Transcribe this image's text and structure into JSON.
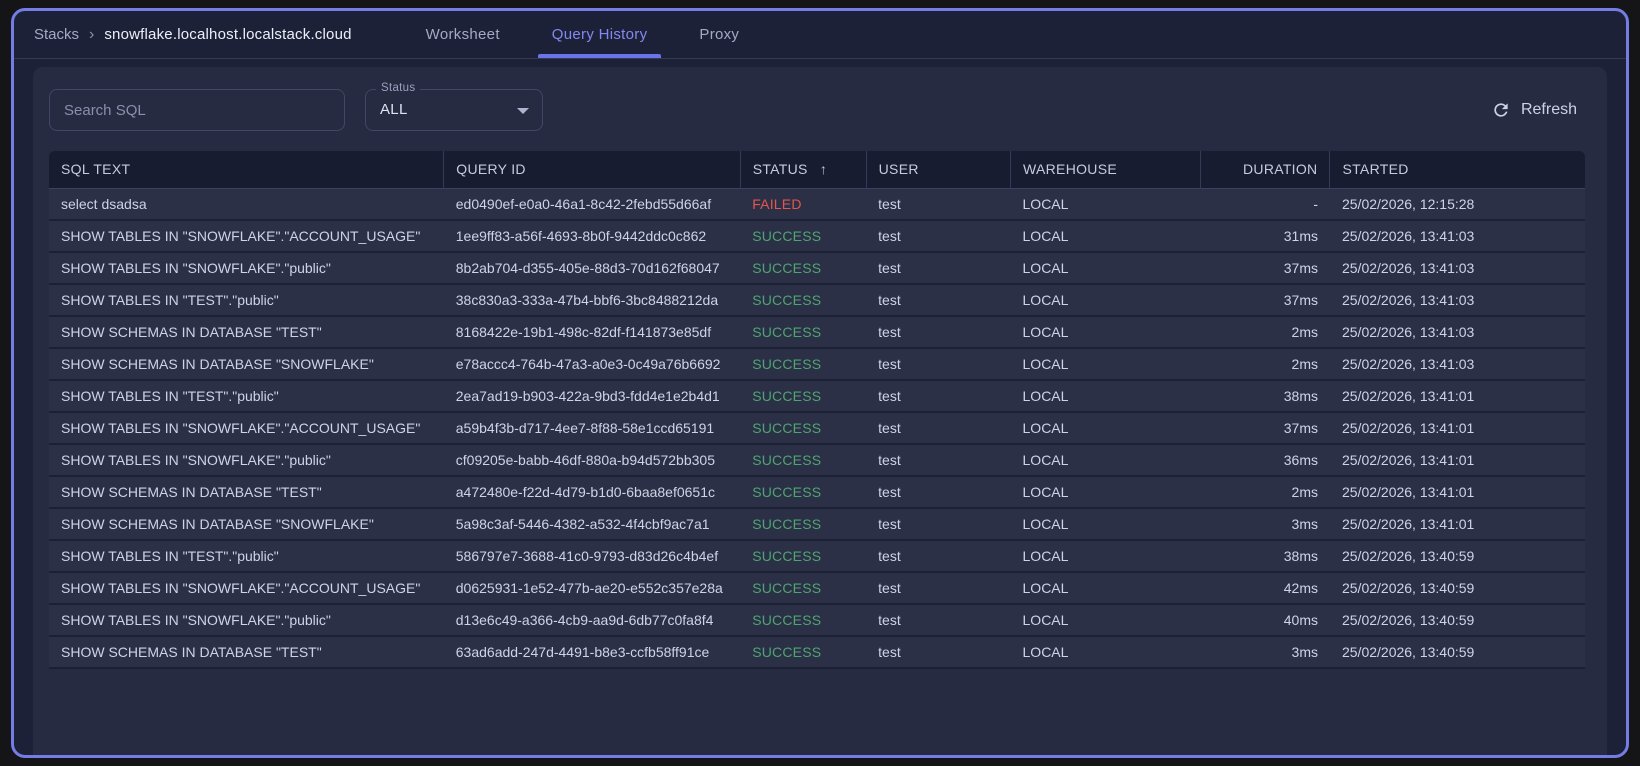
{
  "colors": {
    "accent": "#747ce6",
    "success": "#4fa56f",
    "failed": "#e2574e"
  },
  "breadcrumb": {
    "root": "Stacks",
    "separator": "›",
    "current": "snowflake.localhost.localstack.cloud"
  },
  "tabs": [
    {
      "label": "Worksheet",
      "active": false
    },
    {
      "label": "Query History",
      "active": true
    },
    {
      "label": "Proxy",
      "active": false
    }
  ],
  "toolbar": {
    "search_placeholder": "Search SQL",
    "status_filter": {
      "label": "Status",
      "value": "ALL"
    },
    "refresh_label": "Refresh"
  },
  "table": {
    "columns": [
      "SQL TEXT",
      "QUERY ID",
      "STATUS",
      "USER",
      "WAREHOUSE",
      "DURATION",
      "STARTED"
    ],
    "sort": {
      "column": "STATUS",
      "direction": "asc",
      "arrow": "↑"
    },
    "rows": [
      {
        "sql": "select dsadsa",
        "query_id": "ed0490ef-e0a0-46a1-8c42-2febd55d66af",
        "status": "FAILED",
        "user": "test",
        "warehouse": "LOCAL",
        "duration": "-",
        "started": "25/02/2026, 12:15:28"
      },
      {
        "sql": "SHOW TABLES IN \"SNOWFLAKE\".\"ACCOUNT_USAGE\"",
        "query_id": "1ee9ff83-a56f-4693-8b0f-9442ddc0c862",
        "status": "SUCCESS",
        "user": "test",
        "warehouse": "LOCAL",
        "duration": "31ms",
        "started": "25/02/2026, 13:41:03"
      },
      {
        "sql": "SHOW TABLES IN \"SNOWFLAKE\".\"public\"",
        "query_id": "8b2ab704-d355-405e-88d3-70d162f68047",
        "status": "SUCCESS",
        "user": "test",
        "warehouse": "LOCAL",
        "duration": "37ms",
        "started": "25/02/2026, 13:41:03"
      },
      {
        "sql": "SHOW TABLES IN \"TEST\".\"public\"",
        "query_id": "38c830a3-333a-47b4-bbf6-3bc8488212da",
        "status": "SUCCESS",
        "user": "test",
        "warehouse": "LOCAL",
        "duration": "37ms",
        "started": "25/02/2026, 13:41:03"
      },
      {
        "sql": "SHOW SCHEMAS IN DATABASE \"TEST\"",
        "query_id": "8168422e-19b1-498c-82df-f141873e85df",
        "status": "SUCCESS",
        "user": "test",
        "warehouse": "LOCAL",
        "duration": "2ms",
        "started": "25/02/2026, 13:41:03"
      },
      {
        "sql": "SHOW SCHEMAS IN DATABASE \"SNOWFLAKE\"",
        "query_id": "e78accc4-764b-47a3-a0e3-0c49a76b6692",
        "status": "SUCCESS",
        "user": "test",
        "warehouse": "LOCAL",
        "duration": "2ms",
        "started": "25/02/2026, 13:41:03"
      },
      {
        "sql": "SHOW TABLES IN \"TEST\".\"public\"",
        "query_id": "2ea7ad19-b903-422a-9bd3-fdd4e1e2b4d1",
        "status": "SUCCESS",
        "user": "test",
        "warehouse": "LOCAL",
        "duration": "38ms",
        "started": "25/02/2026, 13:41:01"
      },
      {
        "sql": "SHOW TABLES IN \"SNOWFLAKE\".\"ACCOUNT_USAGE\"",
        "query_id": "a59b4f3b-d717-4ee7-8f88-58e1ccd65191",
        "status": "SUCCESS",
        "user": "test",
        "warehouse": "LOCAL",
        "duration": "37ms",
        "started": "25/02/2026, 13:41:01"
      },
      {
        "sql": "SHOW TABLES IN \"SNOWFLAKE\".\"public\"",
        "query_id": "cf09205e-babb-46df-880a-b94d572bb305",
        "status": "SUCCESS",
        "user": "test",
        "warehouse": "LOCAL",
        "duration": "36ms",
        "started": "25/02/2026, 13:41:01"
      },
      {
        "sql": "SHOW SCHEMAS IN DATABASE \"TEST\"",
        "query_id": "a472480e-f22d-4d79-b1d0-6baa8ef0651c",
        "status": "SUCCESS",
        "user": "test",
        "warehouse": "LOCAL",
        "duration": "2ms",
        "started": "25/02/2026, 13:41:01"
      },
      {
        "sql": "SHOW SCHEMAS IN DATABASE \"SNOWFLAKE\"",
        "query_id": "5a98c3af-5446-4382-a532-4f4cbf9ac7a1",
        "status": "SUCCESS",
        "user": "test",
        "warehouse": "LOCAL",
        "duration": "3ms",
        "started": "25/02/2026, 13:41:01"
      },
      {
        "sql": "SHOW TABLES IN \"TEST\".\"public\"",
        "query_id": "586797e7-3688-41c0-9793-d83d26c4b4ef",
        "status": "SUCCESS",
        "user": "test",
        "warehouse": "LOCAL",
        "duration": "38ms",
        "started": "25/02/2026, 13:40:59"
      },
      {
        "sql": "SHOW TABLES IN \"SNOWFLAKE\".\"ACCOUNT_USAGE\"",
        "query_id": "d0625931-1e52-477b-ae20-e552c357e28a",
        "status": "SUCCESS",
        "user": "test",
        "warehouse": "LOCAL",
        "duration": "42ms",
        "started": "25/02/2026, 13:40:59"
      },
      {
        "sql": "SHOW TABLES IN \"SNOWFLAKE\".\"public\"",
        "query_id": "d13e6c49-a366-4cb9-aa9d-6db77c0fa8f4",
        "status": "SUCCESS",
        "user": "test",
        "warehouse": "LOCAL",
        "duration": "40ms",
        "started": "25/02/2026, 13:40:59"
      },
      {
        "sql": "SHOW SCHEMAS IN DATABASE \"TEST\"",
        "query_id": "63ad6add-247d-4491-b8e3-ccfb58ff91ce",
        "status": "SUCCESS",
        "user": "test",
        "warehouse": "LOCAL",
        "duration": "3ms",
        "started": "25/02/2026, 13:40:59"
      }
    ]
  }
}
